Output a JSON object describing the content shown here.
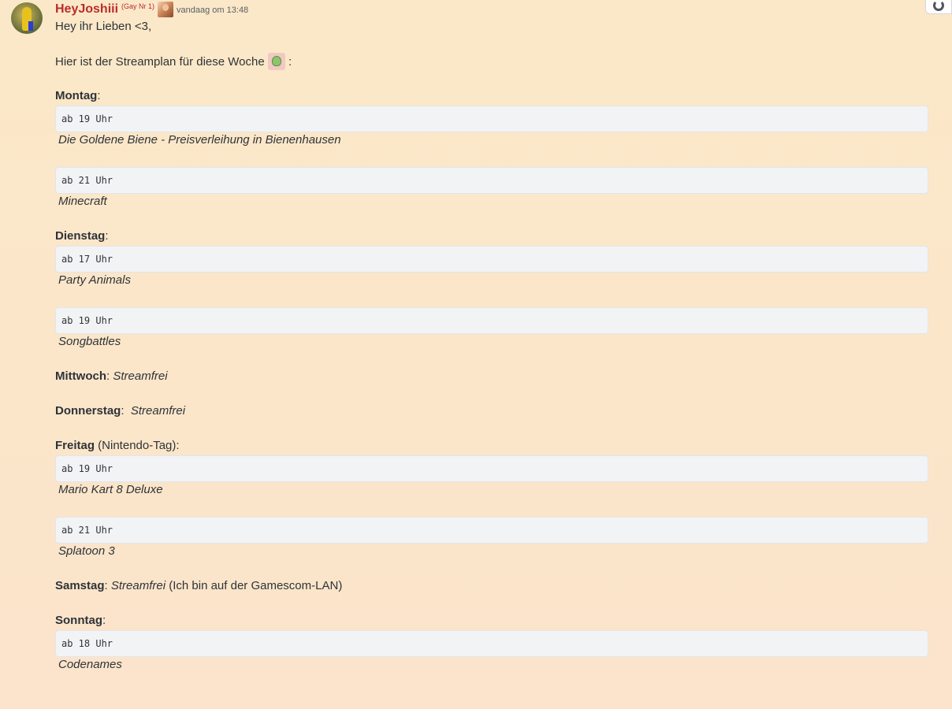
{
  "message": {
    "username": "HeyJoshiii",
    "user_tag": "(Gay Nr 1)",
    "timestamp": "vandaag om 13:48",
    "greeting": "Hey ihr Lieben <3,",
    "intro": "Hier ist der Streamplan für diese Woche",
    "intro_suffix": ":",
    "days": {
      "monday": {
        "label": "Montag",
        "after": ":",
        "slots": [
          {
            "time": "ab 19 Uhr",
            "game": "Die Goldene Biene - Preisverleihung in Bienenhausen"
          },
          {
            "time": "ab 21 Uhr",
            "game": "Minecraft"
          }
        ]
      },
      "tuesday": {
        "label": "Dienstag",
        "after": ":",
        "slots": [
          {
            "time": "ab 17 Uhr",
            "game": "Party Animals"
          },
          {
            "time": "ab 19 Uhr",
            "game": "Songbattles"
          }
        ]
      },
      "wednesday": {
        "label": "Mittwoch",
        "sep": ": ",
        "status": "Streamfrei"
      },
      "thursday": {
        "label": "Donnerstag",
        "sep": ":  ",
        "status": "Streamfrei"
      },
      "friday": {
        "label": "Freitag",
        "after": " (Nintendo-Tag):",
        "slots": [
          {
            "time": "ab 19 Uhr",
            "game": "Mario Kart 8 Deluxe"
          },
          {
            "time": "ab 21 Uhr",
            "game": "Splatoon 3"
          }
        ]
      },
      "saturday": {
        "label": "Samstag",
        "sep": ": ",
        "status": "Streamfrei",
        "note": " (Ich bin auf der Gamescom-LAN)"
      },
      "sunday": {
        "label": "Sonntag",
        "after": ":",
        "slots": [
          {
            "time": "ab 18 Uhr",
            "game": "Codenames"
          }
        ]
      }
    }
  },
  "icons": {
    "emoji": "frog-emoji",
    "role": "role-icon",
    "corner": "refresh-icon"
  }
}
